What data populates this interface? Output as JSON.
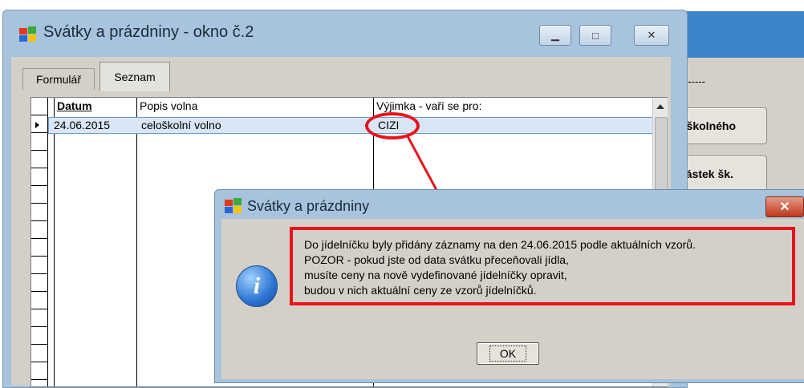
{
  "background_window": {
    "dashes": "------",
    "button1_label": "t školného",
    "button2_label": "částek šk."
  },
  "main_window": {
    "title": "Svátky a prázdniny - okno č.2",
    "minimize": "▁",
    "maximize": "□",
    "close": "✕",
    "tabs": [
      {
        "label": "Formulář"
      },
      {
        "label": "Seznam"
      }
    ],
    "grid": {
      "headers": [
        "Datum",
        "Popis volna",
        "Výjimka - vaří se pro:"
      ],
      "rows": [
        {
          "datum": "24.06.2015",
          "popis": "celoškolní volno",
          "vyjimka": "CIZI"
        }
      ]
    }
  },
  "dialog": {
    "title": "Svátky a prázdniny",
    "close": "✕",
    "info_glyph": "i",
    "message": [
      "Do jídelníčku byly přidány záznamy na den 24.06.2015 podle aktuálních vzorů.",
      "POZOR - pokud jste od data svátku přeceňovali jídla,",
      "musíte ceny na nově vydefinované jídelníčky opravit,",
      "budou v nich aktuální ceny ze vzorů jídelníčků."
    ],
    "ok_label": "OK"
  },
  "colors": {
    "annotation_red": "#e8131b",
    "frame_blue": "#a7c3dd"
  }
}
